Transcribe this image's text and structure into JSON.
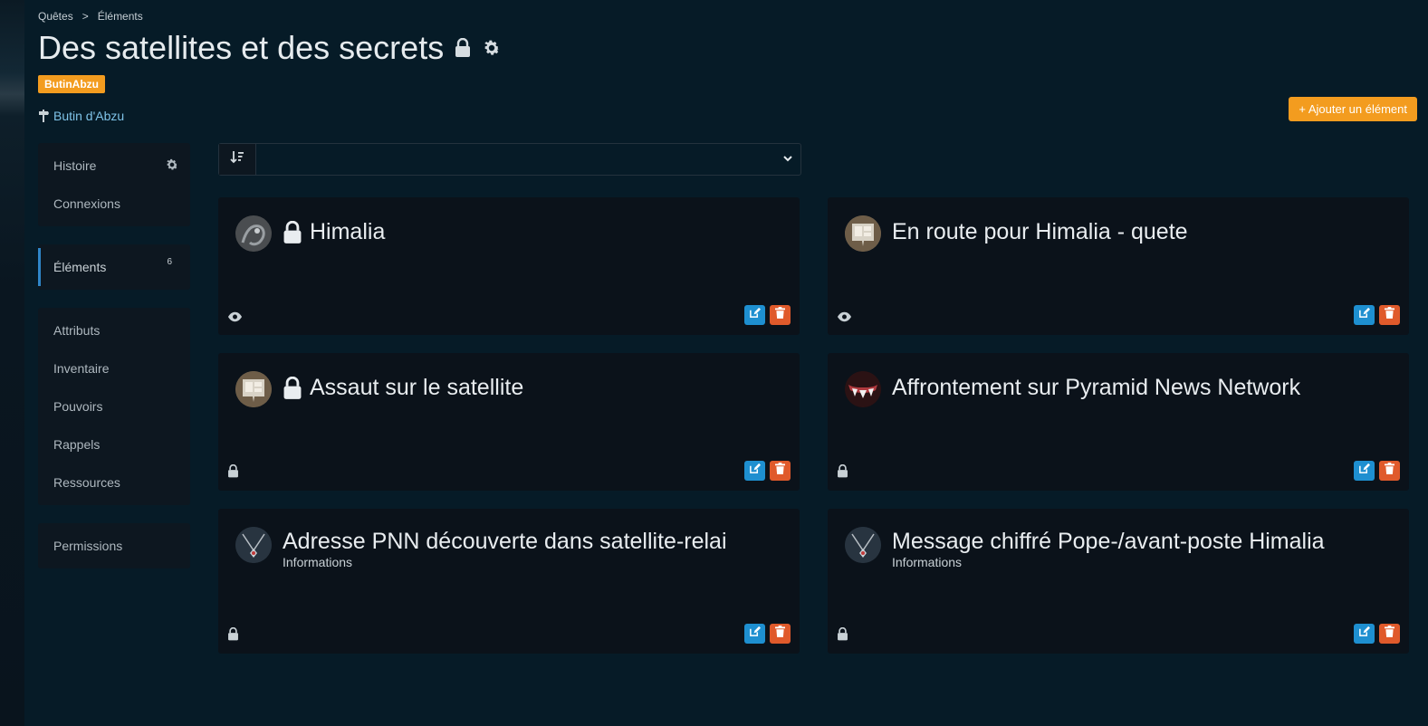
{
  "breadcrumb": {
    "root": "Quêtes",
    "separator": ">",
    "current": "Éléments"
  },
  "page": {
    "title": "Des satellites et des secrets",
    "tag": "ButinAbzu",
    "location": "Butin d'Abzu"
  },
  "actions": {
    "add_label": "+ Ajouter un élément"
  },
  "sidebar": {
    "group1": [
      {
        "label": "Histoire"
      },
      {
        "label": "Connexions"
      }
    ],
    "elements": {
      "label": "Éléments",
      "count": "6"
    },
    "group3": [
      {
        "label": "Attributs"
      },
      {
        "label": "Inventaire"
      },
      {
        "label": "Pouvoirs"
      },
      {
        "label": "Rappels"
      },
      {
        "label": "Ressources"
      }
    ],
    "group4": [
      {
        "label": "Permissions"
      }
    ]
  },
  "sort": {
    "selected": ""
  },
  "cards": [
    {
      "title": "Himalia",
      "subtitle": "",
      "locked_title": true,
      "visibility": "eye-icon",
      "avatar": "dragon"
    },
    {
      "title": "En route pour Himalia - quete",
      "subtitle": "",
      "locked_title": false,
      "visibility": "eye-icon",
      "avatar": "quest-board"
    },
    {
      "title": "Assaut sur le satellite",
      "subtitle": "",
      "locked_title": true,
      "visibility": "lock-icon",
      "avatar": "quest-board"
    },
    {
      "title": "Affrontement sur Pyramid News Network",
      "subtitle": "",
      "locked_title": false,
      "visibility": "lock-icon",
      "avatar": "fangs"
    },
    {
      "title": "Adresse PNN découverte dans satellite-relai",
      "subtitle": "Informations",
      "locked_title": false,
      "visibility": "lock-icon",
      "avatar": "pendant"
    },
    {
      "title": "Message chiffré Pope-/avant-poste Himalia",
      "subtitle": "Informations",
      "locked_title": false,
      "visibility": "lock-icon",
      "avatar": "pendant"
    }
  ],
  "colors": {
    "background": "#061b27",
    "card": "#0b121a",
    "accent": "#f39c1f",
    "edit": "#1e8fd0",
    "delete": "#e05a2b",
    "link": "#7fc3e8"
  }
}
